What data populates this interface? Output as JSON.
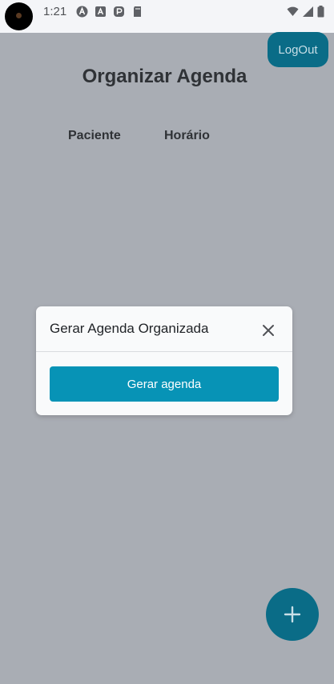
{
  "status_bar": {
    "time": "1:21",
    "left_icons": [
      "app-a-icon",
      "app-text-icon",
      "app-p-icon",
      "sd-card-icon"
    ],
    "right_icons": [
      "wifi-icon",
      "signal-icon",
      "battery-icon"
    ]
  },
  "header": {
    "logout_label": "LogOut",
    "title": "Organizar Agenda"
  },
  "table": {
    "columns": [
      "Paciente",
      "Horário"
    ]
  },
  "modal": {
    "title": "Gerar Agenda Organizada",
    "button_label": "Gerar agenda"
  },
  "colors": {
    "overlay": "#a9adb4",
    "primary": "#0793b6",
    "primary_dimmed": "#0a6c87"
  },
  "fab": {
    "icon": "plus-icon"
  }
}
